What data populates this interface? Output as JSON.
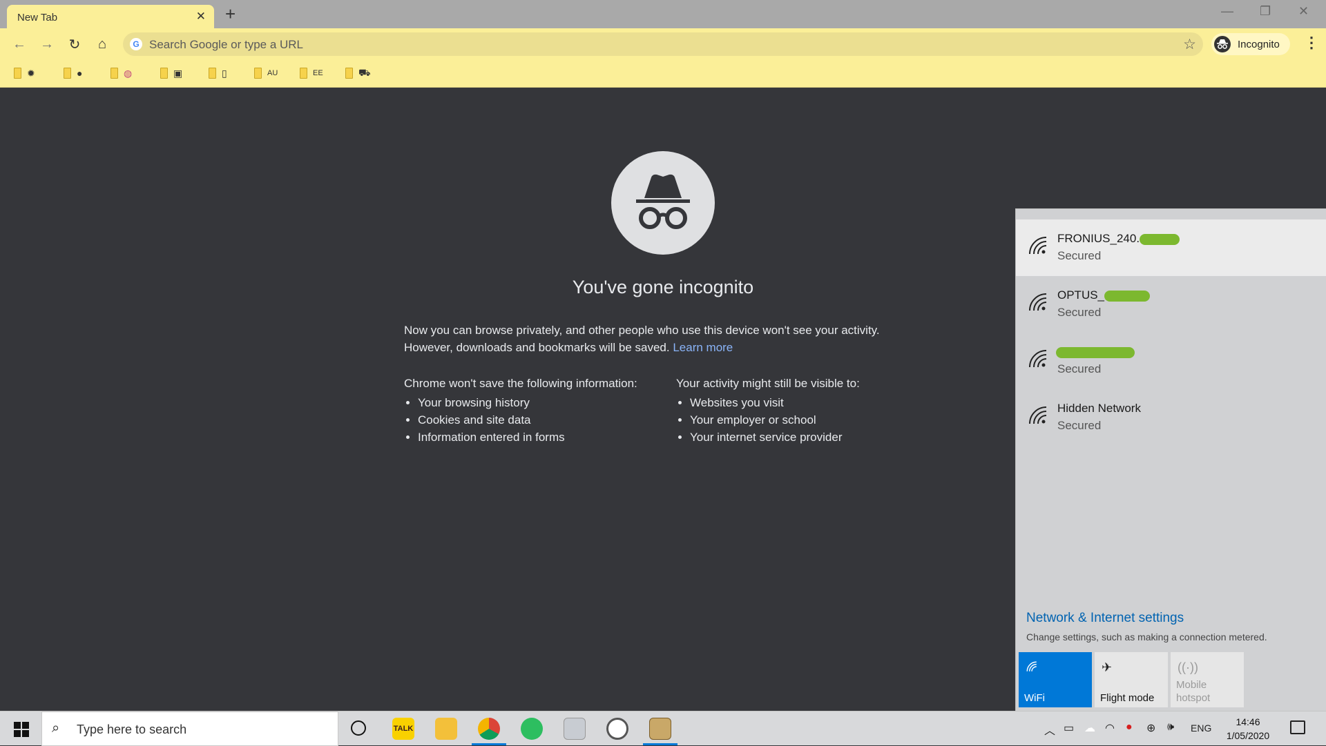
{
  "browser": {
    "tab": {
      "title": "New Tab"
    },
    "new_tab_symbol": "+",
    "window_controls": {
      "minimize": "—",
      "restore": "❐",
      "close": "✕"
    },
    "omnibox": {
      "placeholder": "Search Google or type a URL"
    },
    "profile_label": "Incognito",
    "bookmarks": [
      {
        "favicon": "sun-icon"
      },
      {
        "favicon": "coin-icon"
      },
      {
        "favicon": "chat-bubble-icon"
      },
      {
        "favicon": "tv-icon"
      },
      {
        "favicon": "phone-icon"
      },
      {
        "text": "AU"
      },
      {
        "text": "EE"
      },
      {
        "favicon": "car-icon"
      }
    ]
  },
  "incognito_page": {
    "headline": "You've gone incognito",
    "intro_line1": "Now you can browse privately, and other people who use this device won't see your activity.",
    "intro_line2": "However, downloads and bookmarks will be saved. ",
    "learn_more": "Learn more",
    "left_heading": "Chrome won't save the following information:",
    "left_items": [
      "Your browsing history",
      "Cookies and site data",
      "Information entered in forms"
    ],
    "right_heading": "Your activity might still be visible to:",
    "right_items": [
      "Websites you visit",
      "Your employer or school",
      "Your internet service provider"
    ]
  },
  "network_flyout": {
    "networks": [
      {
        "name": "FRONIUS_240.",
        "status": "Secured"
      },
      {
        "name": "OPTUS_",
        "status": "Secured"
      },
      {
        "name": "",
        "status": "Secured"
      },
      {
        "name": "Hidden Network",
        "status": "Secured"
      }
    ],
    "settings_link": "Network & Internet settings",
    "settings_desc": "Change settings, such as making a connection metered.",
    "quick_actions": [
      {
        "label": "WiFi",
        "state": "on"
      },
      {
        "label": "Flight mode",
        "state": "off"
      },
      {
        "label": "Mobile hotspot",
        "state": "disabled"
      }
    ],
    "colors": {
      "link": "#0063b1",
      "accent": "#0078d7",
      "redaction": "#7cb82f"
    }
  },
  "taskbar": {
    "search_placeholder": "Type here to search",
    "apps": [
      "kakaotalk-icon",
      "file-explorer-icon",
      "chrome-icon",
      "evernote-icon",
      "photos-icon",
      "wordpress-icon",
      "tool-icon"
    ],
    "tray": {
      "language": "ENG",
      "time": "14:46",
      "date": "1/05/2020"
    }
  }
}
